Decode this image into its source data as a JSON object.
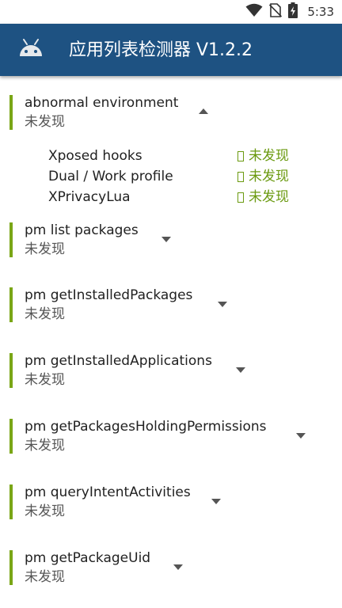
{
  "status_bar": {
    "time": "5:33",
    "icons": [
      "wifi-icon",
      "no-sim-icon",
      "battery-charging-icon"
    ]
  },
  "app_bar": {
    "title": "应用列表检测器 V1.2.2",
    "logo": "android-icon",
    "color": "#1e5282"
  },
  "accent_color": "#7aa616",
  "status_color": "#6b9a10",
  "sections": [
    {
      "title": "abnormal environment",
      "status": "未发现",
      "expanded": true,
      "items": [
        {
          "label": "Xposed hooks",
          "status": "未发现"
        },
        {
          "label": "Dual / Work profile",
          "status": "未发现"
        },
        {
          "label": "XPrivacyLua",
          "status": "未发现"
        }
      ]
    },
    {
      "title": "pm list packages",
      "status": "未发现",
      "expanded": false
    },
    {
      "title": "pm getInstalledPackages",
      "status": "未发现",
      "expanded": false
    },
    {
      "title": "pm getInstalledApplications",
      "status": "未发现",
      "expanded": false
    },
    {
      "title": "pm getPackagesHoldingPermissions",
      "status": "未发现",
      "expanded": false
    },
    {
      "title": "pm queryIntentActivities",
      "status": "未发现",
      "expanded": false
    },
    {
      "title": "pm getPackageUid",
      "status": "未发现",
      "expanded": false
    }
  ]
}
